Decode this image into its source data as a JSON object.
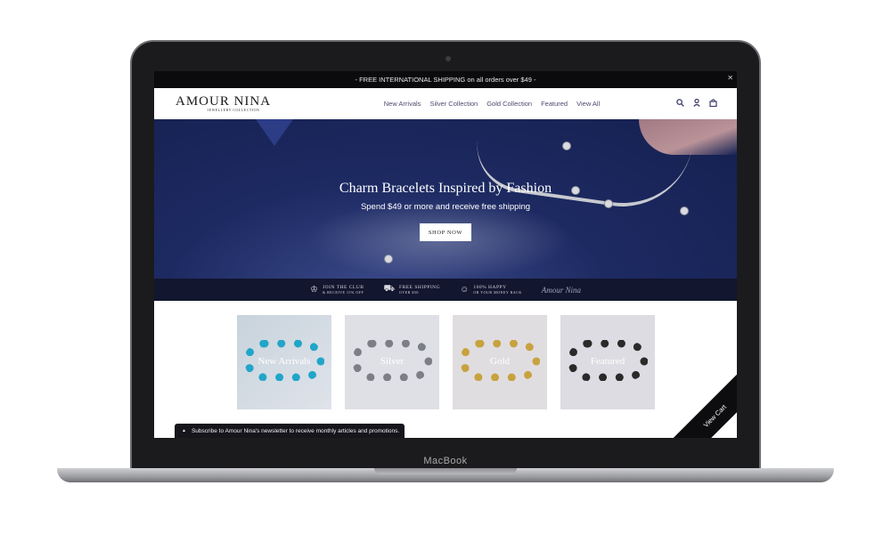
{
  "device": {
    "brand_label": "MacBook"
  },
  "announcement": {
    "text": "- FREE INTERNATIONAL SHIPPING on all orders over $49 -",
    "close_icon": "close-icon"
  },
  "header": {
    "logo_main": "AMOUR NINA",
    "logo_sub": "JEWELLERY COLLECTION",
    "nav": [
      "New Arrivals",
      "Silver Collection",
      "Gold Collection",
      "Featured",
      "View All"
    ],
    "icons": [
      "search-icon",
      "user-icon",
      "cart-icon"
    ]
  },
  "hero": {
    "title": "Charm Bracelets Inspired by Fashion",
    "subtitle": "Spend $49 or more and receive free shipping",
    "button": "SHOP NOW"
  },
  "perks": [
    {
      "icon": "crown-icon",
      "title": "JOIN THE CLUB",
      "sub": "& RECEIVE 15% OFF"
    },
    {
      "icon": "truck-icon",
      "title": "FREE SHIPPING",
      "sub": "OVER $50"
    },
    {
      "icon": "smile-icon",
      "title": "100% HAPPY",
      "sub": "OR YOUR MONEY BACK"
    }
  ],
  "signature": "Amour Nina",
  "collections": [
    "New Arrivals",
    "Silver",
    "Gold",
    "Featured"
  ],
  "newsletter": {
    "text": "Subscribe to Amour Nina's newsletter to receive monthly articles and promotions."
  },
  "view_cart": "View Cart",
  "colors": {
    "hero_bg": "#1d2a62",
    "nav_text": "#4b4b6e",
    "perk_bar": "#12162e"
  }
}
